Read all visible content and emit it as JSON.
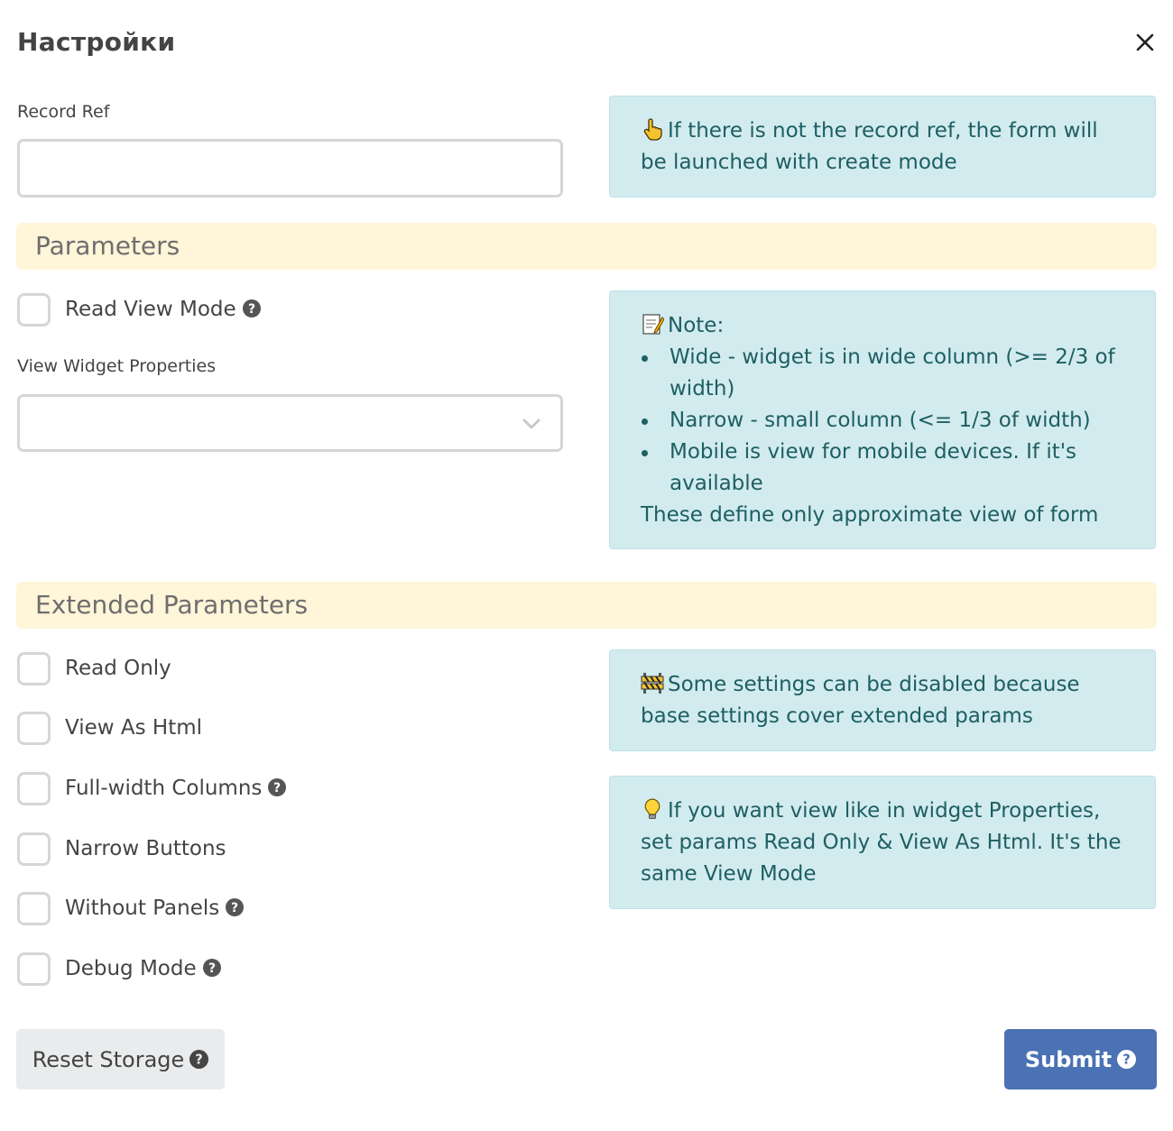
{
  "dialog": {
    "title": "Настройки"
  },
  "record_ref": {
    "label": "Record Ref",
    "value": "",
    "placeholder": ""
  },
  "info_record_ref": {
    "icon": "pointing-hand-icon",
    "text": "If there is not the record ref, the form will be launched with create mode"
  },
  "parameters": {
    "heading": "Parameters",
    "read_view_mode": {
      "label": "Read View Mode",
      "checked": false
    },
    "view_widget_properties": {
      "label": "View Widget Properties",
      "value": ""
    }
  },
  "info_note": {
    "icon": "memo-icon",
    "title": "Note:",
    "items": [
      "Wide - widget is in wide column (>= 2/3 of width)",
      "Narrow - small column (<= 1/3 of width)",
      "Mobile is view for mobile devices. If it's available"
    ],
    "footer": "These define only approximate view of form"
  },
  "extended": {
    "heading": "Extended Parameters",
    "options": [
      {
        "label": "Read Only",
        "checked": false,
        "help": false
      },
      {
        "label": "View As Html",
        "checked": false,
        "help": false
      },
      {
        "label": "Full-width Columns",
        "checked": false,
        "help": true
      },
      {
        "label": "Narrow Buttons",
        "checked": false,
        "help": false
      },
      {
        "label": "Without Panels",
        "checked": false,
        "help": true
      },
      {
        "label": "Debug Mode",
        "checked": false,
        "help": true
      }
    ]
  },
  "info_disabled": {
    "icon": "construction-barrier-icon",
    "text": "Some settings can be disabled because base settings cover extended params"
  },
  "info_tip": {
    "icon": "light-bulb-icon",
    "text": "If you want view like in widget Properties, set params Read Only & View As Html. It's the same View Mode"
  },
  "footer": {
    "reset_label": "Reset Storage",
    "submit_label": "Submit"
  },
  "colors": {
    "info_bg": "#d2ebef",
    "info_text": "#1d5f62",
    "section_bg": "#fff5d9",
    "submit_bg": "#4a72b4"
  }
}
